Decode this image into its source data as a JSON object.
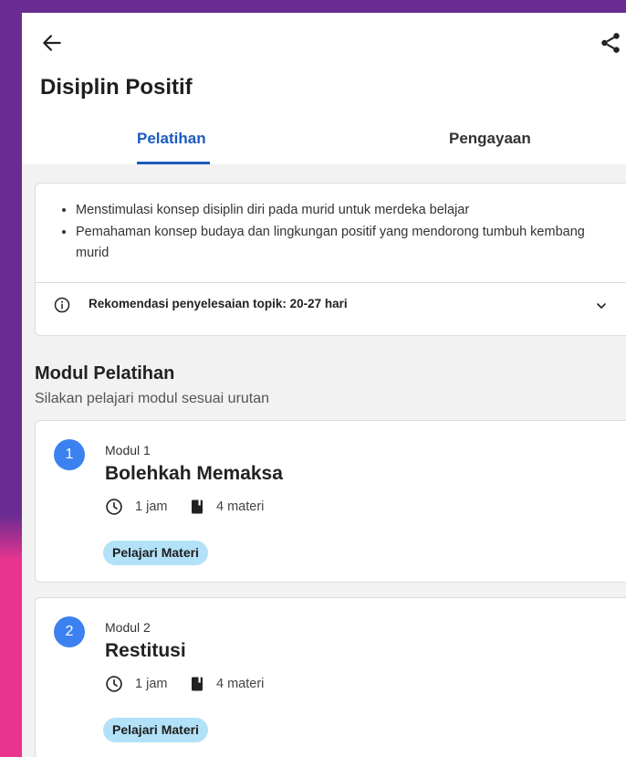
{
  "page": {
    "title": "Disiplin Positif"
  },
  "tabs": [
    {
      "label": "Pelatihan",
      "active": true
    },
    {
      "label": "Pengayaan",
      "active": false
    }
  ],
  "info": {
    "bullets": [
      "Menstimulasi konsep disiplin diri pada murid untuk merdeka belajar",
      "Pemahaman konsep budaya dan lingkungan positif yang mendorong tumbuh kembang murid"
    ],
    "recommendation": "Rekomendasi penyelesaian topik: 20-27 hari"
  },
  "section": {
    "title": "Modul Pelatihan",
    "subtitle": "Silakan pelajari modul sesuai urutan"
  },
  "modules": [
    {
      "number": "1",
      "label": "Modul 1",
      "title": "Bolehkah Memaksa",
      "duration": "1 jam",
      "materials": "4 materi",
      "cta": "Pelajari Materi"
    },
    {
      "number": "2",
      "label": "Modul 2",
      "title": "Restitusi",
      "duration": "1 jam",
      "materials": "4 materi",
      "cta": "Pelajari Materi"
    }
  ],
  "icons": {
    "back": "arrow-left-icon",
    "share": "share-icon",
    "info": "info-icon",
    "expand": "chevron-down-icon",
    "duration": "clock-icon",
    "materials": "book-icon"
  },
  "colors": {
    "accent": "#1b5bbf",
    "number_badge": "#3b82f0",
    "cta_pill": "#b3e1f8",
    "frame_top": "#6a2c92",
    "frame_bottom": "#e8348f",
    "background": "#f2f2f2"
  }
}
